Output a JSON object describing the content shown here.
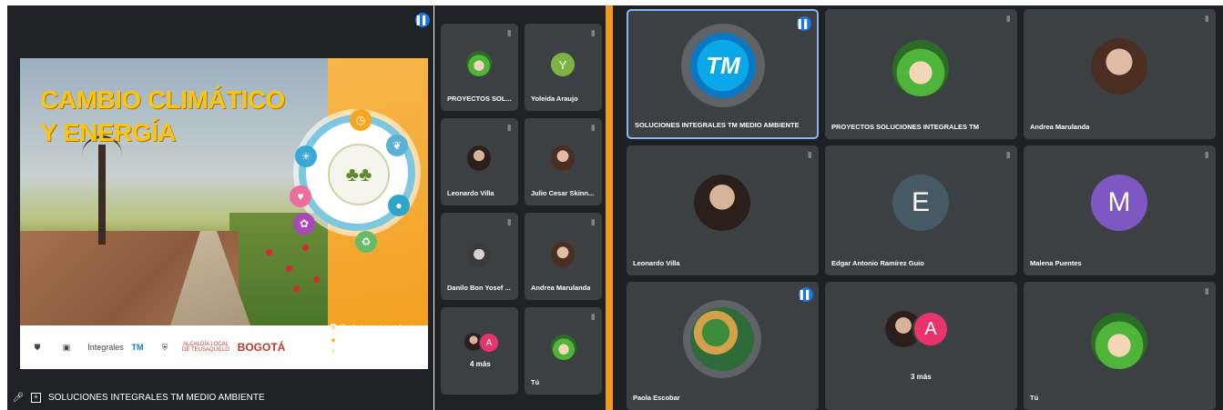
{
  "presentation": {
    "slide_title_line1": "CAMBIO CLIMÁTICO",
    "slide_title_line2": "Y ENERGÍA",
    "footer_logos": [
      "Integrales",
      "ALCALDÍA LOCAL DE TEUSAQUILLO",
      "BOGOTÁ"
    ],
    "social": [
      "@soluciones_integrales_tm",
      "@soluciones.integrales.tm",
      "Soluciones Integrales TM"
    ],
    "presenter_name": "SOLUCIONES INTEGRALES TM MEDIO AMBIENTE"
  },
  "sidebar_tiles": [
    {
      "name": "PROYECTOS SOL...",
      "avatar": "elf"
    },
    {
      "name": "Yoleida Araujo",
      "avatar_letter": "Y",
      "color": "#7cb342"
    },
    {
      "name": "Leonardo Villa",
      "avatar": "photo"
    },
    {
      "name": "Julio Cesar Skinn...",
      "avatar": "photo"
    },
    {
      "name": "Danilo Bon Yosef ...",
      "avatar": "photo"
    },
    {
      "name": "Andrea Marulanda",
      "avatar": "photo"
    },
    {
      "name": "4 más",
      "avatar_letter": "A",
      "color": "#e8336d"
    },
    {
      "name": "Tú",
      "avatar": "elf"
    }
  ],
  "grid_tiles": [
    {
      "name": "SOLUCIONES INTEGRALES TM MEDIO AMBIENTE",
      "logo_text": "TM",
      "speaking": true
    },
    {
      "name": "PROYECTOS SOLUCIONES INTEGRALES TM",
      "avatar": "elf"
    },
    {
      "name": "Andrea Marulanda",
      "avatar": "photo"
    },
    {
      "name": "Leonardo Villa",
      "avatar": "photo"
    },
    {
      "name": "Edgar Antonio Ramírez Guio",
      "avatar_letter": "E",
      "color": "#455a64"
    },
    {
      "name": "Malena Puentes",
      "avatar_letter": "M",
      "color": "#7e57c2"
    },
    {
      "name": "Paola Escobar",
      "avatar": "photo",
      "speaking": true
    },
    {
      "name": "3 más",
      "avatar_letter": "A",
      "color": "#e8336d"
    },
    {
      "name": "Tú",
      "avatar": "elf"
    }
  ],
  "icons": {
    "pin": "pin-icon",
    "speaking": "sound-wave-icon",
    "mic": "mic-icon",
    "present": "present-screen-icon"
  },
  "colors": {
    "background": "#202124",
    "tile": "#3c4043",
    "active_border": "#8ab4f8",
    "divider": "#f29a1c",
    "speaking": "#1a73e8"
  }
}
